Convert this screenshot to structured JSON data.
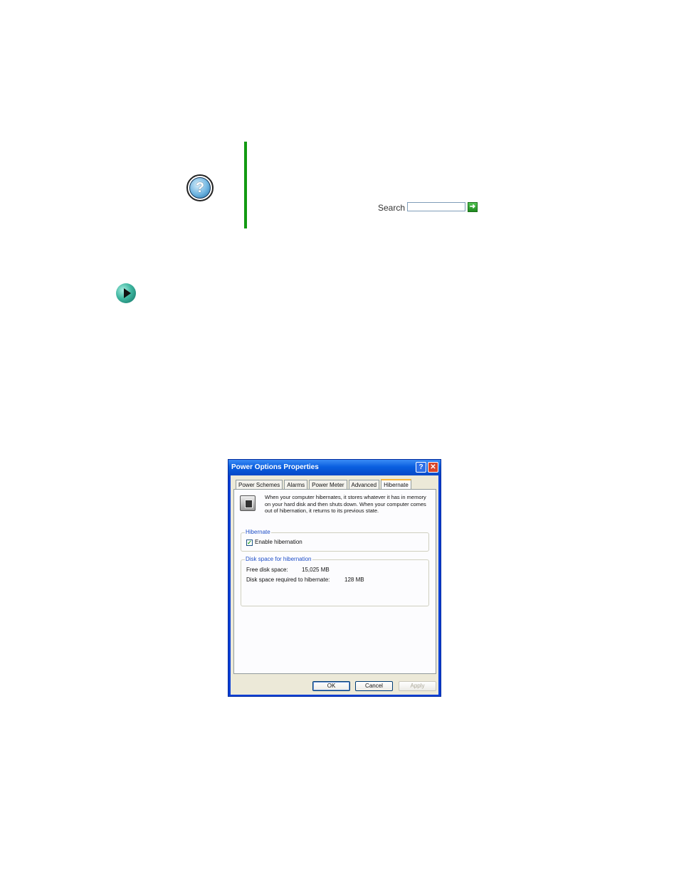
{
  "help_box": {
    "search_label": "Search",
    "search_value": "",
    "icon": "help-question-icon",
    "go_icon": "go-arrow-icon",
    "accent_color": "#139a13"
  },
  "bullet": {
    "icon": "arrow-right-icon"
  },
  "dialog": {
    "title": "Power Options Properties",
    "title_help": "?",
    "title_close": "✕",
    "tabs": [
      "Power Schemes",
      "Alarms",
      "Power Meter",
      "Advanced",
      "Hibernate"
    ],
    "active_tab": "Hibernate",
    "description": "When your computer hibernates, it stores whatever it has in memory on your hard disk and then shuts down. When your computer comes out of hibernation, it returns to its previous state.",
    "hibernate_group": {
      "title": "Hibernate",
      "checkbox_label": "Enable hibernation",
      "checked": true,
      "check_mark": "✓"
    },
    "disk_group": {
      "title": "Disk space for hibernation",
      "free_label": "Free disk space:",
      "free_value": "15,025 MB",
      "required_label": "Disk space required to hibernate:",
      "required_value": "128 MB"
    },
    "buttons": {
      "ok": "OK",
      "cancel": "Cancel",
      "apply": "Apply"
    }
  }
}
